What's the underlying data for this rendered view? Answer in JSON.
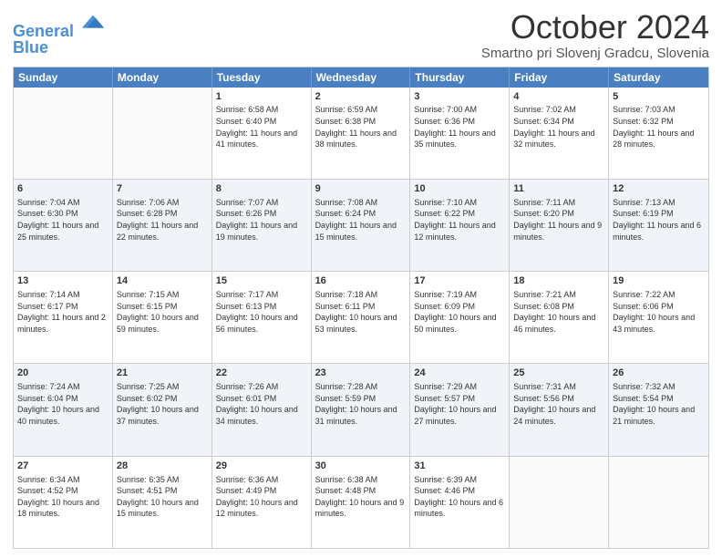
{
  "logo": {
    "line1": "General",
    "line2": "Blue"
  },
  "title": "October 2024",
  "subtitle": "Smartno pri Slovenj Gradcu, Slovenia",
  "days": [
    "Sunday",
    "Monday",
    "Tuesday",
    "Wednesday",
    "Thursday",
    "Friday",
    "Saturday"
  ],
  "weeks": [
    [
      {
        "day": "",
        "sunrise": "",
        "sunset": "",
        "daylight": "",
        "empty": true
      },
      {
        "day": "",
        "sunrise": "",
        "sunset": "",
        "daylight": "",
        "empty": true
      },
      {
        "day": "1",
        "sunrise": "Sunrise: 6:58 AM",
        "sunset": "Sunset: 6:40 PM",
        "daylight": "Daylight: 11 hours and 41 minutes."
      },
      {
        "day": "2",
        "sunrise": "Sunrise: 6:59 AM",
        "sunset": "Sunset: 6:38 PM",
        "daylight": "Daylight: 11 hours and 38 minutes."
      },
      {
        "day": "3",
        "sunrise": "Sunrise: 7:00 AM",
        "sunset": "Sunset: 6:36 PM",
        "daylight": "Daylight: 11 hours and 35 minutes."
      },
      {
        "day": "4",
        "sunrise": "Sunrise: 7:02 AM",
        "sunset": "Sunset: 6:34 PM",
        "daylight": "Daylight: 11 hours and 32 minutes."
      },
      {
        "day": "5",
        "sunrise": "Sunrise: 7:03 AM",
        "sunset": "Sunset: 6:32 PM",
        "daylight": "Daylight: 11 hours and 28 minutes."
      }
    ],
    [
      {
        "day": "6",
        "sunrise": "Sunrise: 7:04 AM",
        "sunset": "Sunset: 6:30 PM",
        "daylight": "Daylight: 11 hours and 25 minutes."
      },
      {
        "day": "7",
        "sunrise": "Sunrise: 7:06 AM",
        "sunset": "Sunset: 6:28 PM",
        "daylight": "Daylight: 11 hours and 22 minutes."
      },
      {
        "day": "8",
        "sunrise": "Sunrise: 7:07 AM",
        "sunset": "Sunset: 6:26 PM",
        "daylight": "Daylight: 11 hours and 19 minutes."
      },
      {
        "day": "9",
        "sunrise": "Sunrise: 7:08 AM",
        "sunset": "Sunset: 6:24 PM",
        "daylight": "Daylight: 11 hours and 15 minutes."
      },
      {
        "day": "10",
        "sunrise": "Sunrise: 7:10 AM",
        "sunset": "Sunset: 6:22 PM",
        "daylight": "Daylight: 11 hours and 12 minutes."
      },
      {
        "day": "11",
        "sunrise": "Sunrise: 7:11 AM",
        "sunset": "Sunset: 6:20 PM",
        "daylight": "Daylight: 11 hours and 9 minutes."
      },
      {
        "day": "12",
        "sunrise": "Sunrise: 7:13 AM",
        "sunset": "Sunset: 6:19 PM",
        "daylight": "Daylight: 11 hours and 6 minutes."
      }
    ],
    [
      {
        "day": "13",
        "sunrise": "Sunrise: 7:14 AM",
        "sunset": "Sunset: 6:17 PM",
        "daylight": "Daylight: 11 hours and 2 minutes."
      },
      {
        "day": "14",
        "sunrise": "Sunrise: 7:15 AM",
        "sunset": "Sunset: 6:15 PM",
        "daylight": "Daylight: 10 hours and 59 minutes."
      },
      {
        "day": "15",
        "sunrise": "Sunrise: 7:17 AM",
        "sunset": "Sunset: 6:13 PM",
        "daylight": "Daylight: 10 hours and 56 minutes."
      },
      {
        "day": "16",
        "sunrise": "Sunrise: 7:18 AM",
        "sunset": "Sunset: 6:11 PM",
        "daylight": "Daylight: 10 hours and 53 minutes."
      },
      {
        "day": "17",
        "sunrise": "Sunrise: 7:19 AM",
        "sunset": "Sunset: 6:09 PM",
        "daylight": "Daylight: 10 hours and 50 minutes."
      },
      {
        "day": "18",
        "sunrise": "Sunrise: 7:21 AM",
        "sunset": "Sunset: 6:08 PM",
        "daylight": "Daylight: 10 hours and 46 minutes."
      },
      {
        "day": "19",
        "sunrise": "Sunrise: 7:22 AM",
        "sunset": "Sunset: 6:06 PM",
        "daylight": "Daylight: 10 hours and 43 minutes."
      }
    ],
    [
      {
        "day": "20",
        "sunrise": "Sunrise: 7:24 AM",
        "sunset": "Sunset: 6:04 PM",
        "daylight": "Daylight: 10 hours and 40 minutes."
      },
      {
        "day": "21",
        "sunrise": "Sunrise: 7:25 AM",
        "sunset": "Sunset: 6:02 PM",
        "daylight": "Daylight: 10 hours and 37 minutes."
      },
      {
        "day": "22",
        "sunrise": "Sunrise: 7:26 AM",
        "sunset": "Sunset: 6:01 PM",
        "daylight": "Daylight: 10 hours and 34 minutes."
      },
      {
        "day": "23",
        "sunrise": "Sunrise: 7:28 AM",
        "sunset": "Sunset: 5:59 PM",
        "daylight": "Daylight: 10 hours and 31 minutes."
      },
      {
        "day": "24",
        "sunrise": "Sunrise: 7:29 AM",
        "sunset": "Sunset: 5:57 PM",
        "daylight": "Daylight: 10 hours and 27 minutes."
      },
      {
        "day": "25",
        "sunrise": "Sunrise: 7:31 AM",
        "sunset": "Sunset: 5:56 PM",
        "daylight": "Daylight: 10 hours and 24 minutes."
      },
      {
        "day": "26",
        "sunrise": "Sunrise: 7:32 AM",
        "sunset": "Sunset: 5:54 PM",
        "daylight": "Daylight: 10 hours and 21 minutes."
      }
    ],
    [
      {
        "day": "27",
        "sunrise": "Sunrise: 6:34 AM",
        "sunset": "Sunset: 4:52 PM",
        "daylight": "Daylight: 10 hours and 18 minutes."
      },
      {
        "day": "28",
        "sunrise": "Sunrise: 6:35 AM",
        "sunset": "Sunset: 4:51 PM",
        "daylight": "Daylight: 10 hours and 15 minutes."
      },
      {
        "day": "29",
        "sunrise": "Sunrise: 6:36 AM",
        "sunset": "Sunset: 4:49 PM",
        "daylight": "Daylight: 10 hours and 12 minutes."
      },
      {
        "day": "30",
        "sunrise": "Sunrise: 6:38 AM",
        "sunset": "Sunset: 4:48 PM",
        "daylight": "Daylight: 10 hours and 9 minutes."
      },
      {
        "day": "31",
        "sunrise": "Sunrise: 6:39 AM",
        "sunset": "Sunset: 4:46 PM",
        "daylight": "Daylight: 10 hours and 6 minutes."
      },
      {
        "day": "",
        "sunrise": "",
        "sunset": "",
        "daylight": "",
        "empty": true
      },
      {
        "day": "",
        "sunrise": "",
        "sunset": "",
        "daylight": "",
        "empty": true
      }
    ]
  ]
}
